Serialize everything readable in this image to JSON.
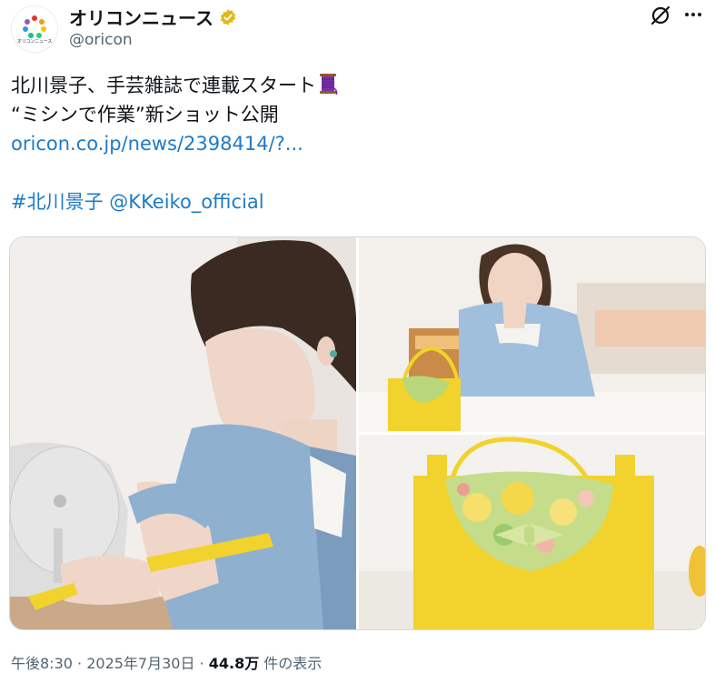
{
  "account": {
    "avatar_text": "オリコンニュース",
    "name": "オリコンニュース",
    "handle": "@oricon"
  },
  "tweet": {
    "line1": "北川景子、手芸雑誌で連載スタート",
    "line2": "“ミシンで作業”新ショット公開",
    "link": "oricon.co.jp/news/2398414/?...",
    "hashtag": "#北川景子",
    "mention": "@KKeiko_official",
    "emoji": "thread-spool-icon"
  },
  "footer": {
    "time": "午後8:30",
    "sep1": " · ",
    "date": "2025年7月30日",
    "sep2": " · ",
    "views": "44.8万",
    "views_label": " 件の表示"
  },
  "colors": {
    "link": "#1d7bc8",
    "verified": "#e2b719",
    "secondary_text": "#536471",
    "felt_yellow": "#f2d22c"
  },
  "icons": {
    "verified": "verified-badge-icon",
    "grok": "grok-icon",
    "more": "more-dots-icon"
  }
}
